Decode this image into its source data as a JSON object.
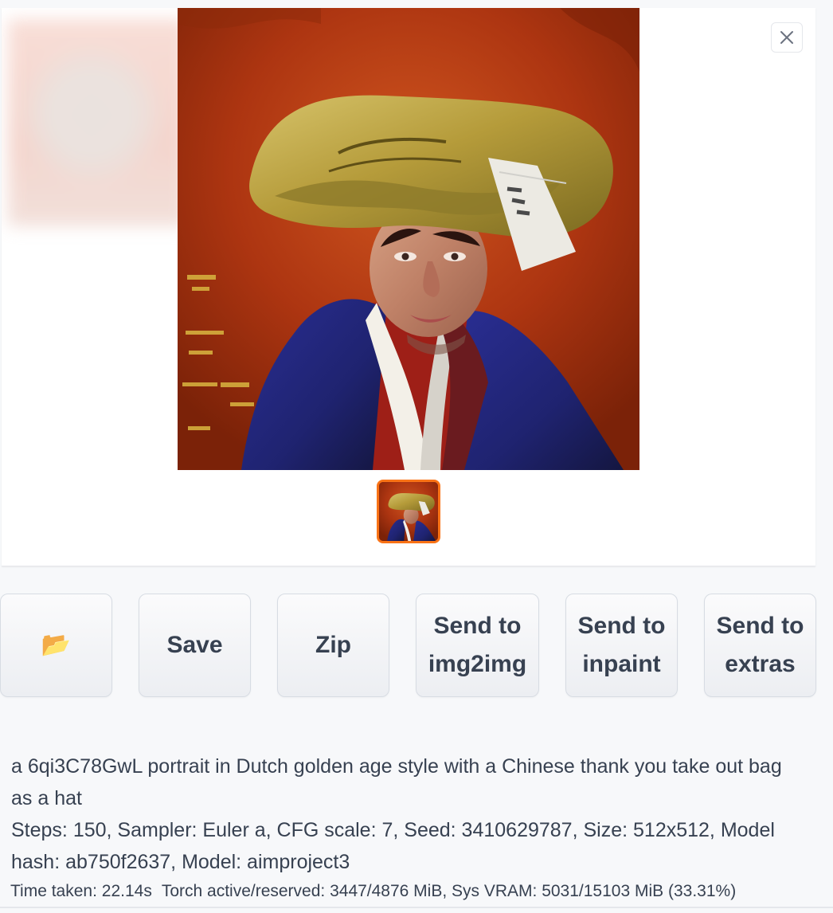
{
  "buttons": {
    "folder_icon": "📂",
    "save": "Save",
    "zip": "Zip",
    "send_img2img": "Send to\nimg2img",
    "send_inpaint": "Send to\ninpaint",
    "send_extras": "Send to\nextras"
  },
  "info": {
    "prompt": "a 6qi3C78GwL portrait in Dutch golden age style with a Chinese thank you take out bag as a hat",
    "params": "Steps: 150, Sampler: Euler a, CFG scale: 7, Seed: 3410629787, Size: 512x512, Model hash: ab750f2637, Model: aimproject3"
  },
  "footer": {
    "time_taken": "Time taken: 22.14s",
    "torch": "Torch active/reserved: 3447/4876 MiB, Sys VRAM: 5031/15103 MiB (33.31%)"
  },
  "colors": {
    "accent": "#f97316",
    "button_text": "#374151",
    "panel": "#ffffff",
    "background": "#f7f8fa"
  }
}
